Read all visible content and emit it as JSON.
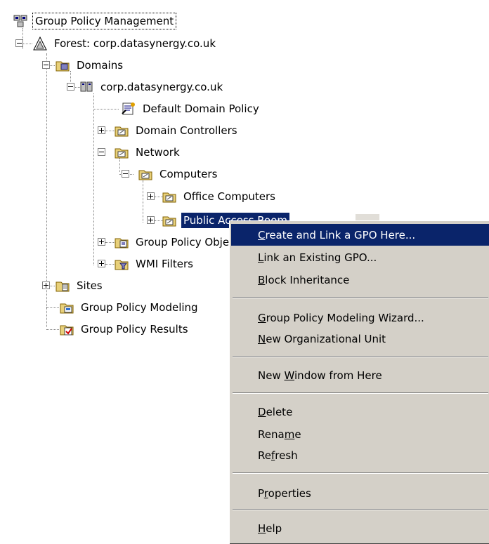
{
  "tree": {
    "root": "Group Policy Management",
    "forest": "Forest: corp.datasynergy.co.uk",
    "domains": "Domains",
    "domain": "corp.datasynergy.co.uk",
    "default_domain_policy": "Default Domain Policy",
    "domain_controllers": "Domain Controllers",
    "network": "Network",
    "computers": "Computers",
    "office_computers": "Office Computers",
    "public_access_room": "Public Access Room",
    "group_policy_objects": "Group Policy Objects",
    "wmi_filters": "WMI Filters",
    "sites": "Sites",
    "group_policy_modeling": "Group Policy Modeling",
    "group_policy_results": "Group Policy Results"
  },
  "context_menu": {
    "create_link_gpo": {
      "u": "C",
      "rest": "reate and Link a GPO Here..."
    },
    "link_existing_gpo": {
      "u": "L",
      "rest": "ink an Existing GPO..."
    },
    "block_inheritance": {
      "u": "B",
      "rest": "lock Inheritance"
    },
    "gp_modeling_wizard": {
      "u": "G",
      "rest": "roup Policy Modeling Wizard..."
    },
    "new_ou": {
      "u": "N",
      "rest": "ew Organizational Unit"
    },
    "new_window": {
      "pre": "New ",
      "u": "W",
      "rest": "indow from Here"
    },
    "delete": {
      "u": "D",
      "rest": "elete"
    },
    "rename": {
      "pre": "Rena",
      "u": "m",
      "rest": "e"
    },
    "refresh": {
      "pre": "Re",
      "u": "f",
      "rest": "resh"
    },
    "properties": {
      "pre": "P",
      "u": "r",
      "rest": "operties"
    },
    "help": {
      "u": "H",
      "rest": "elp"
    }
  },
  "colors": {
    "selection": "#0a246a",
    "menu_background": "#d4d0c8",
    "folder": "#e8d07a"
  }
}
